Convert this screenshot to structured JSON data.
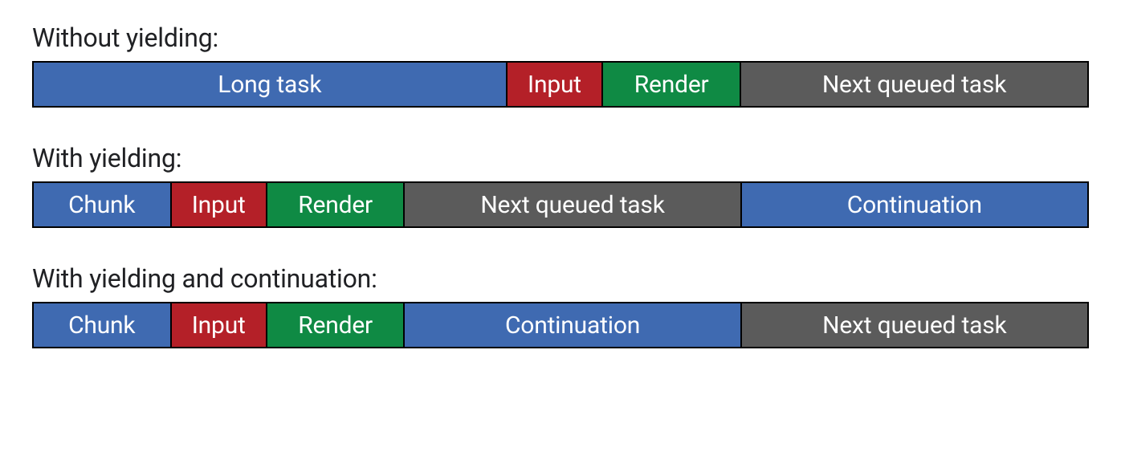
{
  "colors": {
    "blue": "#3f6ab1",
    "red": "#b42028",
    "green": "#0f8a44",
    "gray": "#5b5b5b"
  },
  "sections": [
    {
      "title": "Without yielding:",
      "segments": [
        {
          "label": "Long task",
          "color": "blue",
          "flex": 45
        },
        {
          "label": "Input",
          "color": "red",
          "flex": 9
        },
        {
          "label": "Render",
          "color": "green",
          "flex": 13
        },
        {
          "label": "Next queued task",
          "color": "gray",
          "flex": 33
        }
      ]
    },
    {
      "title": "With yielding:",
      "segments": [
        {
          "label": "Chunk",
          "color": "blue",
          "flex": 13
        },
        {
          "label": "Input",
          "color": "red",
          "flex": 9
        },
        {
          "label": "Render",
          "color": "green",
          "flex": 13
        },
        {
          "label": "Next queued task",
          "color": "gray",
          "flex": 32
        },
        {
          "label": "Continuation",
          "color": "blue",
          "flex": 33
        }
      ]
    },
    {
      "title": "With yielding and continuation:",
      "segments": [
        {
          "label": "Chunk",
          "color": "blue",
          "flex": 13
        },
        {
          "label": "Input",
          "color": "red",
          "flex": 9
        },
        {
          "label": "Render",
          "color": "green",
          "flex": 13
        },
        {
          "label": "Continuation",
          "color": "blue",
          "flex": 32
        },
        {
          "label": "Next queued task",
          "color": "gray",
          "flex": 33
        }
      ]
    }
  ]
}
